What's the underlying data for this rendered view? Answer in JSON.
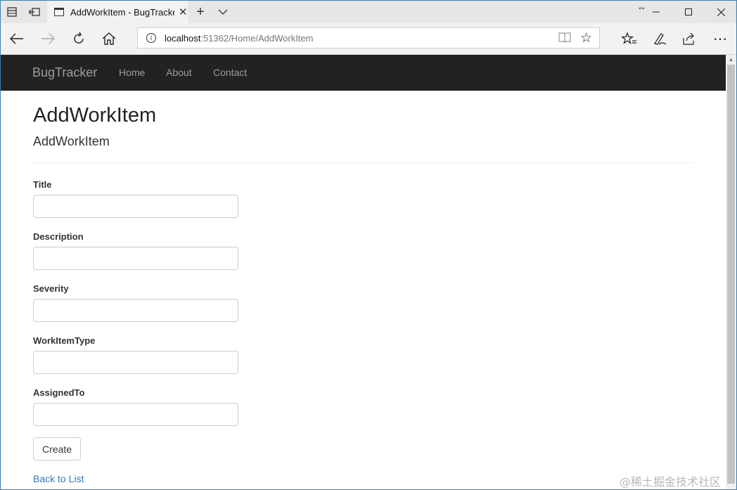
{
  "browser": {
    "tab": {
      "title": "AddWorkItem - BugTracker"
    },
    "window_controls": {
      "resize_glyph": "↔"
    },
    "address": {
      "host": "localhost",
      "rest": ":51362/Home/AddWorkItem"
    },
    "icons": [
      "tab-preview-icon",
      "set-tabs-aside-icon",
      "close-icon",
      "new-tab-icon",
      "tab-list-chevron-icon",
      "back-icon",
      "forward-icon",
      "refresh-icon",
      "home-icon",
      "info-icon",
      "reading-view-icon",
      "favorite-star-icon",
      "favorites-hub-icon",
      "pen-icon",
      "share-icon",
      "more-icon"
    ]
  },
  "site": {
    "brand": "BugTracker",
    "nav": [
      "Home",
      "About",
      "Contact"
    ]
  },
  "page": {
    "title": "AddWorkItem",
    "subtitle": "AddWorkItem",
    "fields": [
      {
        "label": "Title",
        "value": ""
      },
      {
        "label": "Description",
        "value": ""
      },
      {
        "label": "Severity",
        "value": ""
      },
      {
        "label": "WorkItemType",
        "value": ""
      },
      {
        "label": "AssignedTo",
        "value": ""
      }
    ],
    "submit_label": "Create",
    "back_link": "Back to List"
  },
  "watermark": "@稀土掘金技术社区",
  "colors": {
    "navbar_bg": "#222222",
    "nav_text": "#9d9d9d",
    "link": "#337ab7",
    "window_border": "#3c7fb1"
  }
}
